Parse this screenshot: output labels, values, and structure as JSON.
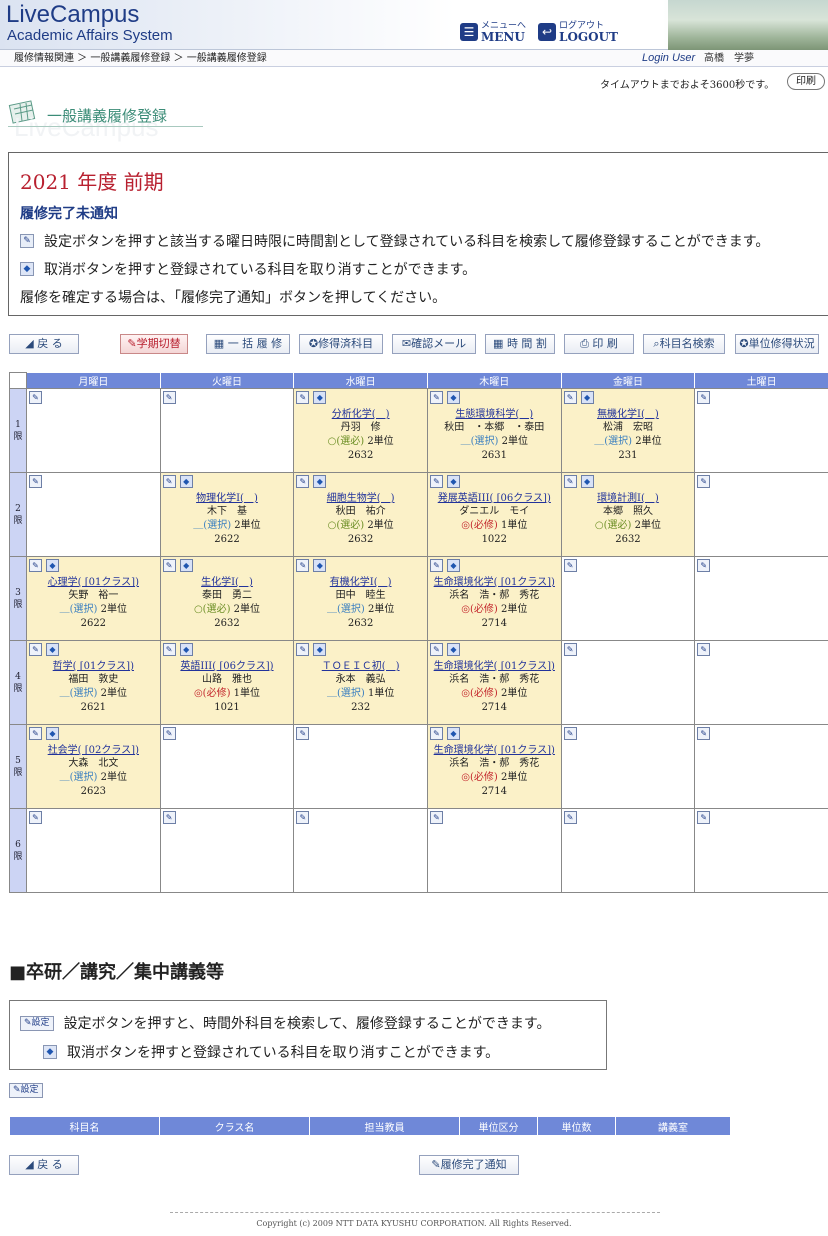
{
  "header": {
    "logo_title": "LiveCampus",
    "logo_sub": "Academic Affairs System",
    "menu_small": "メニューへ",
    "menu_big": "MENU",
    "logout_small": "ログアウト",
    "logout_big": "LOGOUT"
  },
  "breadcrumb": "履修情報関連 ＞ 一般講義履修登録 ＞ 一般講義履修登録",
  "login_label": "Login User",
  "user_name": "高橋　学夢",
  "timeout_text": "タイムアウトまでおよそ3600秒です。",
  "print_top": "印刷",
  "page_title": "一般講義履修登録",
  "title_shadow": "LiveCampus",
  "info": {
    "term": "2021 年度 前期",
    "status": "履修完了未通知",
    "line1": "設定ボタンを押すと該当する曜日時限に時間割として登録されている科目を検索して履修登録することができます。",
    "line2": "取消ボタンを押すと登録されている科目を取り消すことができます。",
    "line3": "履修を確定する場合は、「履修完了通知」ボタンを押してください。"
  },
  "toolbar": {
    "back": "戻 る",
    "term_switch": "学期切替",
    "bulk": "一 括 履 修",
    "completed": "修得済科目",
    "confirm_mail": "確認メール",
    "timetable": "時 間 割",
    "print": "印 刷",
    "course_search": "科目名検索",
    "credit_status": "単位修得状況"
  },
  "days": [
    "月曜日",
    "火曜日",
    "水曜日",
    "木曜日",
    "金曜日",
    "土曜日"
  ],
  "periods": [
    "1\n限",
    "2\n限",
    "3\n限",
    "4\n限",
    "5\n限",
    "6\n限"
  ],
  "timetable": [
    [
      null,
      null,
      {
        "name": "分析化学(　)",
        "teacher": "丹羽　修",
        "type": "○(選必)",
        "typeclass": "opt",
        "credits": "2単位",
        "room": "2632"
      },
      {
        "name": "生態環境科学(　)",
        "teacher": "秋田　・本郷　・泰田",
        "type": "＿(選択)",
        "typeclass": "sel",
        "credits": "2単位",
        "room": "2631"
      },
      {
        "name": "無機化学I(　)",
        "teacher": "松浦　宏昭",
        "type": "＿(選択)",
        "typeclass": "sel",
        "credits": "2単位",
        "room": "231"
      },
      null
    ],
    [
      null,
      {
        "name": "物理化学I(　)",
        "teacher": "木下　基",
        "type": "＿(選択)",
        "typeclass": "sel",
        "credits": "2単位",
        "room": "2622"
      },
      {
        "name": "細胞生物学(　)",
        "teacher": "秋田　祐介",
        "type": "○(選必)",
        "typeclass": "opt",
        "credits": "2単位",
        "room": "2632"
      },
      {
        "name": "発展英語III( [06クラス])",
        "teacher": "ダニエル　モイ",
        "type": "◎(必修)",
        "typeclass": "req",
        "credits": "1単位",
        "room": "1022"
      },
      {
        "name": "環境計測I(　)",
        "teacher": "本郷　照久",
        "type": "○(選必)",
        "typeclass": "opt",
        "credits": "2単位",
        "room": "2632"
      },
      null
    ],
    [
      {
        "name": "心理学( [01クラス])",
        "teacher": "矢野　裕一",
        "type": "＿(選択)",
        "typeclass": "sel",
        "credits": "2単位",
        "room": "2622"
      },
      {
        "name": "生化学I(　)",
        "teacher": "泰田　勇二",
        "type": "○(選必)",
        "typeclass": "opt",
        "credits": "2単位",
        "room": "2632"
      },
      {
        "name": "有機化学I(　)",
        "teacher": "田中　睦生",
        "type": "＿(選択)",
        "typeclass": "sel",
        "credits": "2単位",
        "room": "2632"
      },
      {
        "name": "生命環境化学( [01クラス])",
        "teacher": "浜名　浩・郝　秀花",
        "type": "◎(必修)",
        "typeclass": "req",
        "credits": "2単位",
        "room": "2714"
      },
      null,
      null
    ],
    [
      {
        "name": "哲学( [01クラス])",
        "teacher": "福田　敦史",
        "type": "＿(選択)",
        "typeclass": "sel",
        "credits": "2単位",
        "room": "2621"
      },
      {
        "name": "英語III( [06クラス])",
        "teacher": "山路　雅也",
        "type": "◎(必修)",
        "typeclass": "req",
        "credits": "1単位",
        "room": "1021"
      },
      {
        "name": "ＴＯＥＩＣ初(　)",
        "teacher": "永本　義弘",
        "type": "＿(選択)",
        "typeclass": "sel",
        "credits": "1単位",
        "room": "232"
      },
      {
        "name": "生命環境化学( [01クラス])",
        "teacher": "浜名　浩・郝　秀花",
        "type": "◎(必修)",
        "typeclass": "req",
        "credits": "2単位",
        "room": "2714"
      },
      null,
      null
    ],
    [
      {
        "name": "社会学( [02クラス])",
        "teacher": "大森　北文",
        "type": "＿(選択)",
        "typeclass": "sel",
        "credits": "2単位",
        "room": "2623"
      },
      null,
      null,
      {
        "name": "生命環境化学( [01クラス])",
        "teacher": "浜名　浩・郝　秀花",
        "type": "◎(必修)",
        "typeclass": "req",
        "credits": "2単位",
        "room": "2714"
      },
      null,
      null
    ],
    [
      null,
      null,
      null,
      null,
      null,
      null
    ]
  ],
  "section2": {
    "title": "■卒研／講究／集中講義等",
    "set_label": "設定",
    "line1": "設定ボタンを押すと、時間外科目を検索して、履修登録することができます。",
    "line2": "取消ボタンを押すと登録されている科目を取り消すことができます。",
    "columns": [
      "科目名",
      "クラス名",
      "担当教員",
      "単位区分",
      "単位数",
      "講義室"
    ]
  },
  "bottom": {
    "back": "戻 る",
    "complete": "履修完了通知"
  },
  "copyright": "Copyright (c) 2009 NTT DATA KYUSHU CORPORATION. All Rights Reserved."
}
